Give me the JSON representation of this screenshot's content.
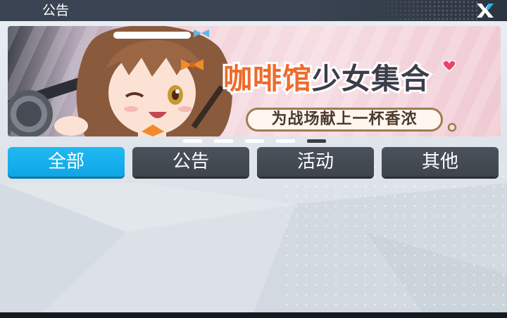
{
  "window": {
    "title": "公告"
  },
  "banner": {
    "title_part1": "咖啡馆",
    "title_part2": "少女集合",
    "subtitle": "为战场献上一杯香浓"
  },
  "pager": {
    "count": 5,
    "active_index": 4
  },
  "tabs": [
    {
      "label": "全部",
      "active": true
    },
    {
      "label": "公告",
      "active": false
    },
    {
      "label": "活动",
      "active": false
    },
    {
      "label": "其他",
      "active": false
    }
  ],
  "colors": {
    "accent": "#15adea",
    "tab_inactive": "#434951",
    "titlebar": "#3b4452",
    "panel": "#e3e8ed"
  }
}
